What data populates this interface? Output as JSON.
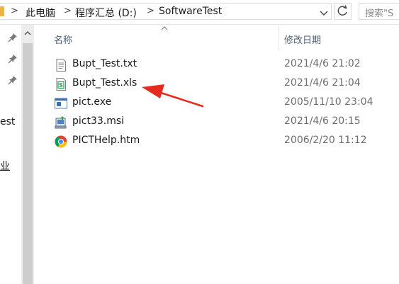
{
  "address": {
    "crumbs": [
      "此电脑",
      "程序汇总 (D:)",
      "SoftwareTest"
    ],
    "separator": ">",
    "search_placeholder": "搜索\"S"
  },
  "nav": {
    "visible_fragments": [
      "est",
      "业"
    ]
  },
  "columns": {
    "name": "名称",
    "modified": "修改日期"
  },
  "files": [
    {
      "name": "Bupt_Test.txt",
      "date": "2021/4/6 21:02",
      "icon": "text-file-icon"
    },
    {
      "name": "Bupt_Test.xls",
      "date": "2021/4/6 21:04",
      "icon": "spreadsheet-file-icon"
    },
    {
      "name": "pict.exe",
      "date": "2005/11/10 23:04",
      "icon": "exe-file-icon"
    },
    {
      "name": "pict33.msi",
      "date": "2021/4/6 20:15",
      "icon": "installer-file-icon"
    },
    {
      "name": "PICTHelp.htm",
      "date": "2006/2/20 11:12",
      "icon": "chrome-html-icon"
    }
  ],
  "annotation": {
    "arrow_color": "#e52a1f"
  }
}
